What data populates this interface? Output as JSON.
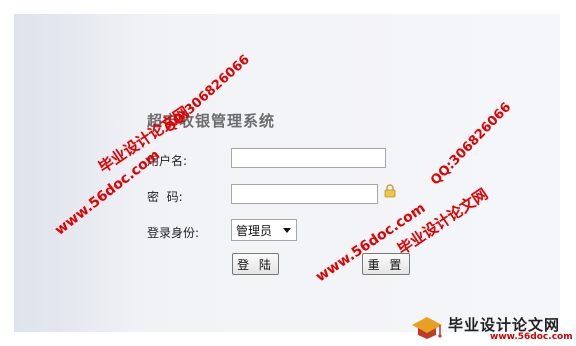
{
  "app": {
    "title": "超市收银管理系统"
  },
  "form": {
    "username_label": "用户名:",
    "username_value": "",
    "password_label": "密  码:",
    "password_value": "",
    "role_label": "登录身份:",
    "role_selected": "管理员",
    "login_button": "登 陆",
    "reset_button": "重 置"
  },
  "watermarks": {
    "site_name": "毕业设计论文网",
    "url": "www.56doc.com",
    "qq": "QQ:306826066"
  },
  "badge": {
    "title": "毕业设计论文网",
    "url": "www.56doc.com"
  },
  "colors": {
    "watermark": "#e00000",
    "panel_background": "#f2f3f7"
  }
}
